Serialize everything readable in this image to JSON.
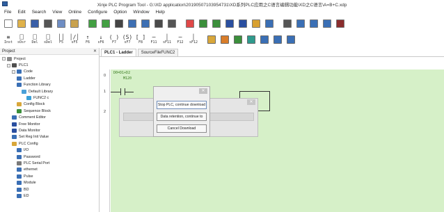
{
  "window": {
    "title": "Xinje PLC Program Tool - G:\\XD application\\20190507103954731\\XD系列PLC应用之C语言编辑功能\\XD之C语言\\A=B+C.xdp"
  },
  "menu": [
    "File",
    "Edit",
    "Search",
    "View",
    "Online",
    "Configure",
    "Option",
    "Window",
    "Help"
  ],
  "toolbar_row1": [
    {
      "name": "new-icon",
      "color": "#ffffff"
    },
    {
      "name": "open-icon",
      "color": "#e0b24a"
    },
    {
      "name": "save-icon",
      "color": "#3a5fa8"
    },
    {
      "name": "cut-icon",
      "color": "#555555"
    },
    {
      "name": "copy-icon",
      "color": "#6f8ec4"
    },
    {
      "name": "paste-icon",
      "color": "#c9a24e"
    },
    {
      "name": "back-icon",
      "color": "#43a043"
    },
    {
      "name": "forward-icon",
      "color": "#43a043"
    },
    {
      "name": "find-icon",
      "color": "#444444"
    },
    {
      "name": "grid-view-icon",
      "color": "#3d6fb3"
    },
    {
      "name": "list-view-icon",
      "color": "#3d6fb3"
    },
    {
      "name": "print-icon",
      "color": "#4a4a4a"
    },
    {
      "name": "config-icon",
      "color": "#555555"
    },
    {
      "name": "download-icon",
      "color": "#e04848"
    },
    {
      "name": "upload-icon",
      "color": "#3b8f3b"
    },
    {
      "name": "run-icon",
      "color": "#3b8f3b"
    },
    {
      "name": "stop-icon",
      "color": "#2a4fa0"
    },
    {
      "name": "monitor-icon",
      "color": "#2a4fa0"
    },
    {
      "name": "lock-icon",
      "color": "#d8a030"
    },
    {
      "name": "user-icon",
      "color": "#3a6fb5"
    },
    {
      "name": "image-icon",
      "color": "#555555"
    },
    {
      "name": "zoom-window-icon",
      "color": "#3a6fb5"
    },
    {
      "name": "zoom-fit-icon",
      "color": "#3a6fb5"
    },
    {
      "name": "zoom-custom-icon",
      "color": "#3a6fb5"
    },
    {
      "name": "dash-icon",
      "color": "#8a2d2d"
    }
  ],
  "ladder_tools": [
    {
      "top": "Inst",
      "name": "instruction-icon"
    },
    {
      "top": "sOsr",
      "name": "coil-set-icon"
    },
    {
      "top": "Del",
      "name": "delete-line-icon"
    },
    {
      "top": "sDel",
      "name": "delete-cell-icon"
    },
    {
      "top": "F5",
      "name": "no-contact-icon"
    },
    {
      "top": "sF5",
      "name": "nc-contact-icon"
    },
    {
      "top": "F6",
      "name": "rise-contact-icon"
    },
    {
      "top": "sF6",
      "name": "fall-contact-icon"
    },
    {
      "top": "F7",
      "name": "coil-icon"
    },
    {
      "top": "sF7",
      "name": "set-coil-icon"
    },
    {
      "top": "F8",
      "name": "func-icon"
    },
    {
      "top": "F11",
      "name": "hline-icon"
    },
    {
      "top": "sF11",
      "name": "vline-icon"
    },
    {
      "top": "F12",
      "name": "del-hline-icon"
    },
    {
      "top": "sF12",
      "name": "del-vline-icon"
    }
  ],
  "toolbar_row2_colors": [
    "#d9a73a",
    "#d97d2a",
    "#3b8f3b",
    "#2f9a8d",
    "#3a6fb5",
    "#3a6fb5",
    "#3a6fb5"
  ],
  "project": {
    "title": "Project",
    "controls": "✕",
    "tree": [
      {
        "label": "Project",
        "depth": 0,
        "color": "#888888",
        "name": "tree-project"
      },
      {
        "label": "PLC1",
        "depth": 1,
        "color": "#4f4f4f",
        "name": "tree-plc1"
      },
      {
        "label": "Code",
        "depth": 2,
        "color": "#3a6fb5",
        "name": "tree-code"
      },
      {
        "label": "Ladder",
        "depth": 3,
        "color": "#3a6fb5",
        "name": "tree-ladder"
      },
      {
        "label": "Function Library",
        "depth": 3,
        "color": "#3a6fb5",
        "name": "tree-function-library"
      },
      {
        "label": "Default Library",
        "depth": 4,
        "color": "#4aa0d8",
        "name": "tree-default-library"
      },
      {
        "label": "FUNC2 c",
        "depth": 5,
        "color": "#3aa0d8",
        "name": "tree-func2"
      },
      {
        "label": "Config Block",
        "depth": 3,
        "color": "#d9a73a",
        "name": "tree-config-block"
      },
      {
        "label": "Sequence Block",
        "depth": 3,
        "color": "#3b8f3b",
        "name": "tree-sequence-block"
      },
      {
        "label": "Comment Editor",
        "depth": 2,
        "color": "#3a6fb5",
        "name": "tree-comment-editor"
      },
      {
        "label": "Free Monitor",
        "depth": 2,
        "color": "#2a4fa0",
        "name": "tree-free-monitor"
      },
      {
        "label": "Data Monitor",
        "depth": 2,
        "color": "#2a4fa0",
        "name": "tree-data-monitor"
      },
      {
        "label": "Set Reg Init Value",
        "depth": 2,
        "color": "#3a6fb5",
        "name": "tree-set-reg-init"
      },
      {
        "label": "PLC Config",
        "depth": 2,
        "color": "#d9a73a",
        "name": "tree-plc-config"
      },
      {
        "label": "I/O",
        "depth": 3,
        "color": "#3a6fb5",
        "name": "tree-io"
      },
      {
        "label": "Password",
        "depth": 3,
        "color": "#3a6fb5",
        "name": "tree-password"
      },
      {
        "label": "PLC Serial Port",
        "depth": 3,
        "color": "#7a7a7a",
        "name": "tree-plc-serial-port"
      },
      {
        "label": "ethernet",
        "depth": 3,
        "color": "#3a6fb5",
        "name": "tree-ethernet"
      },
      {
        "label": "Pulse",
        "depth": 3,
        "color": "#3a6fb5",
        "name": "tree-pulse"
      },
      {
        "label": "Module",
        "depth": 3,
        "color": "#3a6fb5",
        "name": "tree-module"
      },
      {
        "label": "BD",
        "depth": 3,
        "color": "#3a6fb5",
        "name": "tree-bd"
      },
      {
        "label": "ED",
        "depth": 3,
        "color": "#3a6fb5",
        "name": "tree-ed"
      }
    ]
  },
  "tabs": [
    {
      "label": "PLC1 - Ladder",
      "active": true
    },
    {
      "label": "SourceFileFUNC2",
      "active": false
    }
  ],
  "ladder": {
    "rows": [
      "0",
      "1",
      "2"
    ],
    "rung_comment": "D0=D1+D2",
    "contact": "M120"
  },
  "dialog": {
    "close": "✕",
    "buttons": [
      "Stop PLC, continue download",
      "Data retention, continue to",
      "Cancel Download"
    ]
  },
  "back_dialog": {
    "close": "✕"
  }
}
